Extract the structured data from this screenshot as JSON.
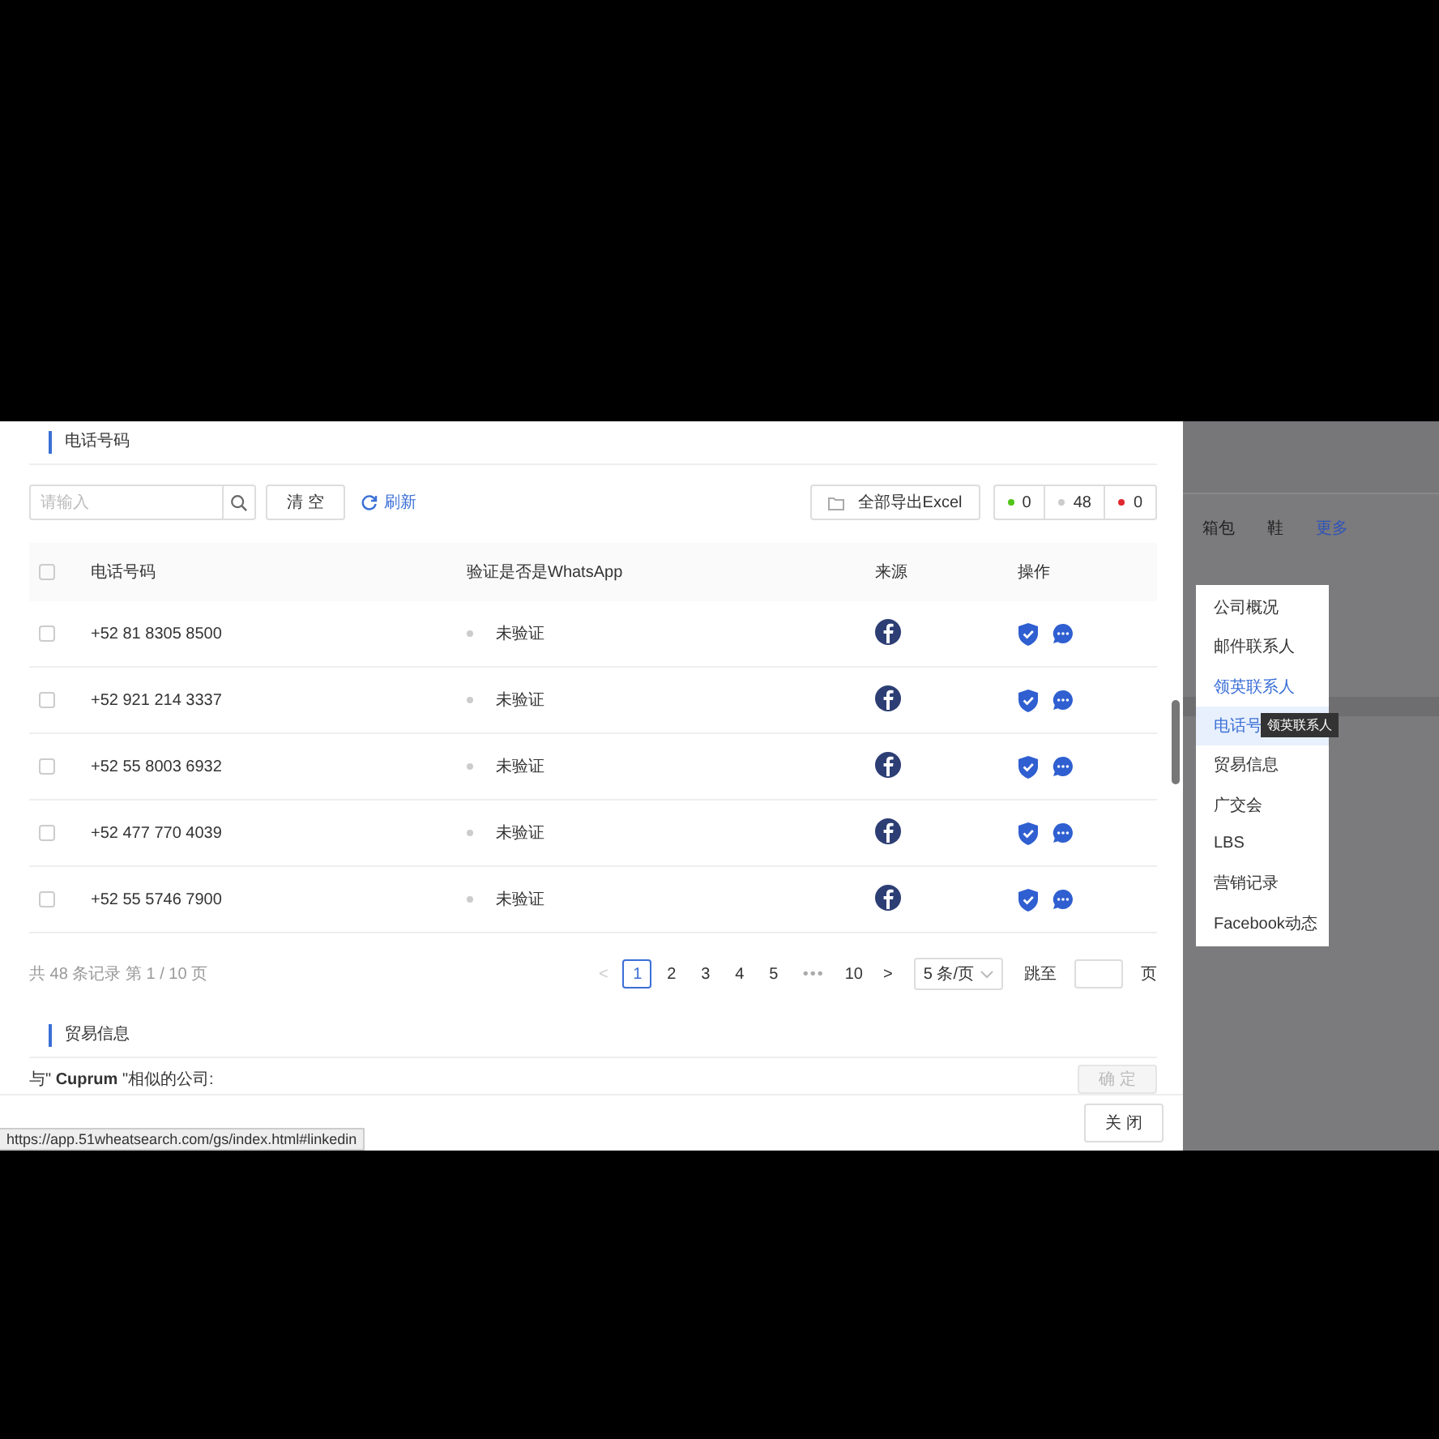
{
  "modal": {
    "section_title": "电话号码",
    "search": {
      "placeholder": "请输入"
    },
    "clear_button": "清 空",
    "refresh_link": "刷新",
    "export_button": "全部导出Excel",
    "counters": [
      {
        "value": "0",
        "color": "#52c41a"
      },
      {
        "value": "48",
        "color": "#cccccc"
      },
      {
        "value": "0",
        "color": "#e0282e"
      }
    ],
    "table": {
      "header_checked": false,
      "columns": [
        "电话号码",
        "验证是否是WhatsApp",
        "来源",
        "操作"
      ],
      "rows": [
        {
          "checked": false,
          "phone": "+52 81 8305 8500",
          "verification": "未验证"
        },
        {
          "checked": false,
          "phone": "+52 921 214 3337",
          "verification": "未验证"
        },
        {
          "checked": false,
          "phone": "+52 55 8003 6932",
          "verification": "未验证"
        },
        {
          "checked": false,
          "phone": "+52 477 770 4039",
          "verification": "未验证"
        },
        {
          "checked": false,
          "phone": "+52 55 5746 7900",
          "verification": "未验证"
        }
      ]
    },
    "pagination": {
      "summary": "共 48 条记录 第 1 / 10 页",
      "prev": {
        "label": "<",
        "disabled": true
      },
      "pages": [
        {
          "kind": "page",
          "label": "1",
          "selected": true
        },
        {
          "kind": "page",
          "label": "2",
          "selected": false
        },
        {
          "kind": "page",
          "label": "3",
          "selected": false
        },
        {
          "kind": "page",
          "label": "4",
          "selected": false
        },
        {
          "kind": "page",
          "label": "5",
          "selected": false
        },
        {
          "kind": "ellipsis",
          "label": "•••"
        },
        {
          "kind": "page",
          "label": "10",
          "selected": false
        }
      ],
      "next": {
        "label": ">",
        "disabled": false
      },
      "page_size": "5 条/页",
      "jump_label": "跳至",
      "jump_suffix": "页"
    },
    "trade_section_title": "贸易信息",
    "similar_text": "与\" **Cuprum** \"相似的公司:",
    "confirm_button": {
      "label": "确 定",
      "disabled": true
    },
    "close_button": "关 闭"
  },
  "background": {
    "tabs": [
      {
        "kind": "tab",
        "label": "箱包"
      },
      {
        "kind": "tab",
        "label": "鞋"
      },
      {
        "kind": "link",
        "label": "更多"
      }
    ]
  },
  "menu": {
    "items": [
      {
        "label": "公司概况",
        "selected": false,
        "hovered": false
      },
      {
        "label": "邮件联系人",
        "selected": false,
        "hovered": false
      },
      {
        "label": "领英联系人",
        "selected": false,
        "hovered": true
      },
      {
        "label": "电话号",
        "selected": true,
        "hovered": false
      },
      {
        "label": "贸易信息",
        "selected": false,
        "hovered": false
      },
      {
        "label": "广交会",
        "selected": false,
        "hovered": false
      },
      {
        "label": "LBS",
        "selected": false,
        "hovered": false
      },
      {
        "label": "营销记录",
        "selected": false,
        "hovered": false
      },
      {
        "label": "Facebook动态",
        "selected": false,
        "hovered": false
      }
    ]
  },
  "tooltip": "领英联系人",
  "status_url": "https://app.51wheatsearch.com/gs/index.html#linkedin"
}
